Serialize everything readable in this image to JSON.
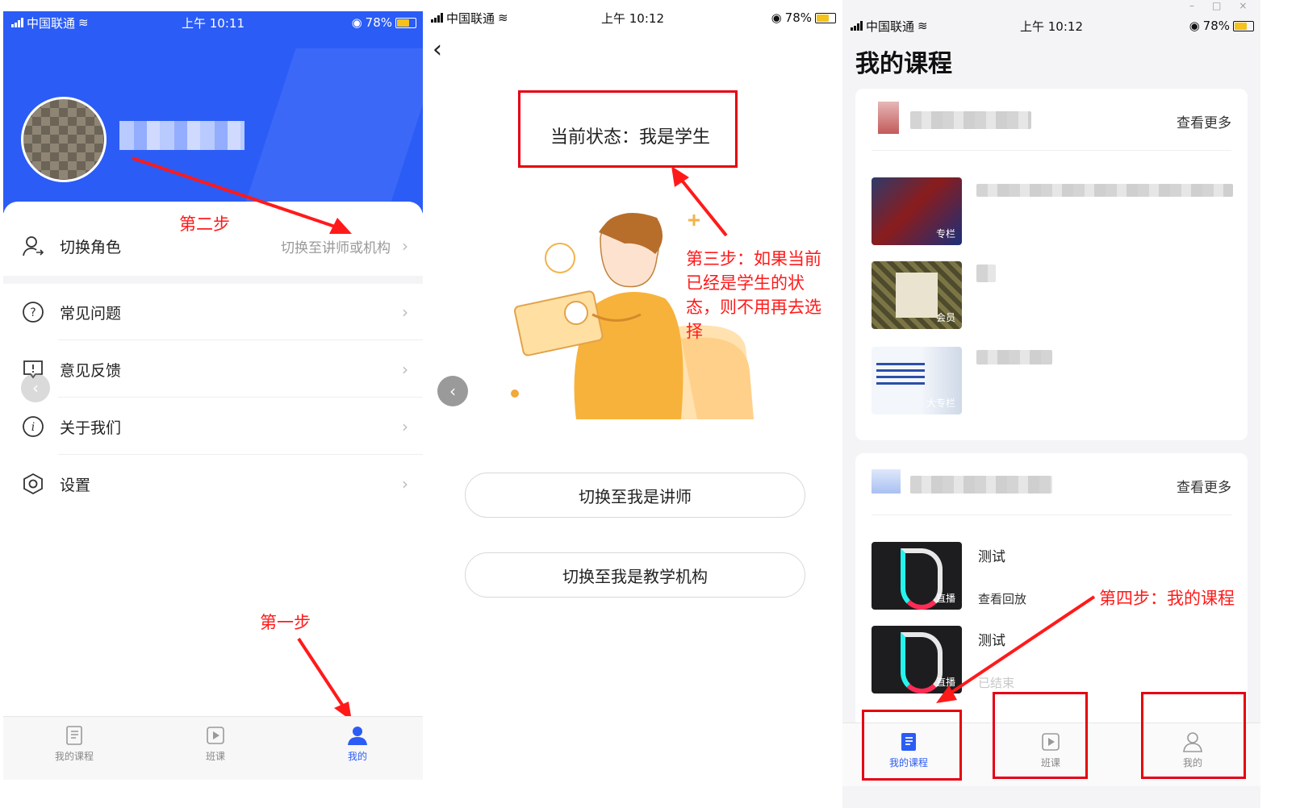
{
  "status": {
    "carrier": "中国联通",
    "battery": "78%",
    "time_panel1": "上午 10:11",
    "time_panel2": "上午 10:12",
    "time_panel3": "上午 10:12"
  },
  "panel1": {
    "menu": [
      {
        "label": "切换角色",
        "value": "切换至讲师或机构",
        "icon": "user-switch-icon"
      },
      {
        "label": "常见问题",
        "value": "",
        "icon": "question-icon"
      },
      {
        "label": "意见反馈",
        "value": "",
        "icon": "feedback-icon"
      },
      {
        "label": "关于我们",
        "value": "",
        "icon": "info-icon"
      },
      {
        "label": "设置",
        "value": "",
        "icon": "settings-icon"
      }
    ],
    "annotation_step1": "第一步",
    "annotation_step2": "第二步"
  },
  "panel2": {
    "current_status": "当前状态：我是学生",
    "annotation_step3": "第三步：如果当前已经是学生的状态，则不用再去选择",
    "buttons": [
      "切换至我是讲师",
      "切换至我是教学机构"
    ]
  },
  "panel3": {
    "title": "我的课程",
    "more_label": "查看更多",
    "card1_tags": [
      "专栏",
      "会员",
      "大专栏"
    ],
    "card2_items": [
      {
        "title": "测试",
        "status": "查看回放",
        "tag": "直播"
      },
      {
        "title": "测试",
        "status": "已结束",
        "tag": "直播"
      }
    ],
    "annotation_step4": "第四步：我的课程"
  },
  "tabs": [
    "我的课程",
    "班课",
    "我的"
  ],
  "colors": {
    "brand_blue": "#2b5cf6",
    "annotation_red": "#ff1a1a",
    "box_red": "#e60012"
  }
}
